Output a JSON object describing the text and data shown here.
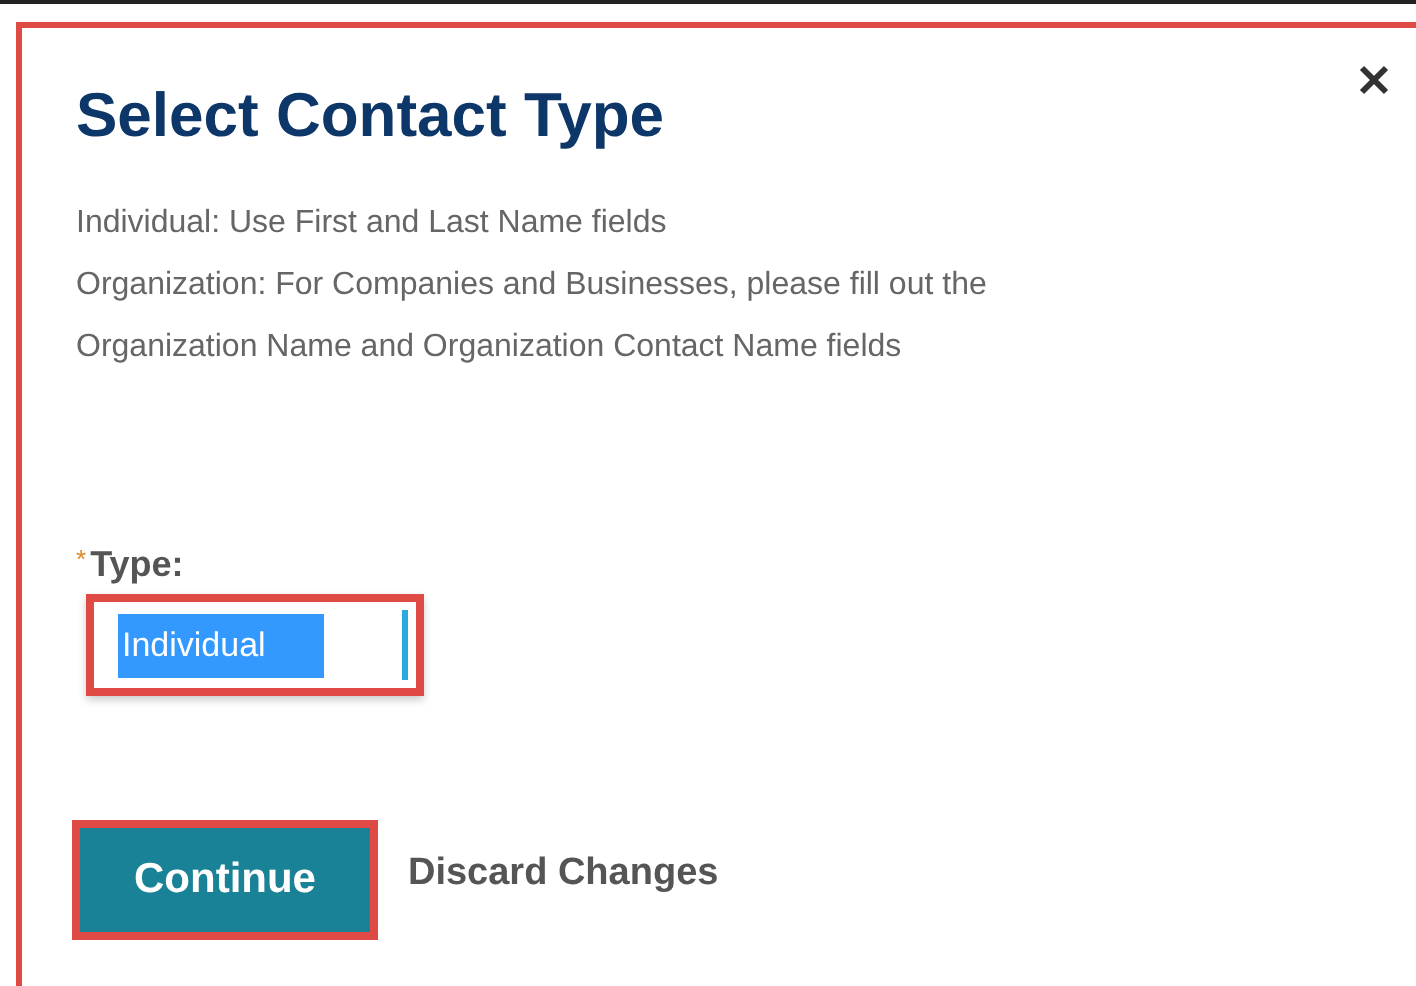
{
  "dialog": {
    "title": "Select Contact Type",
    "description": [
      "Individual: Use First and Last Name fields",
      "Organization: For Companies and Businesses, please fill out the",
      "Organization Name and Organization Contact Name fields"
    ],
    "type_field": {
      "required_mark": "*",
      "label": "Type:",
      "value": "Individual",
      "value_highlighted": true
    },
    "actions": [
      {
        "label": "Continue",
        "kind": "primary"
      },
      {
        "label": "Discard Changes",
        "kind": "link"
      }
    ]
  }
}
